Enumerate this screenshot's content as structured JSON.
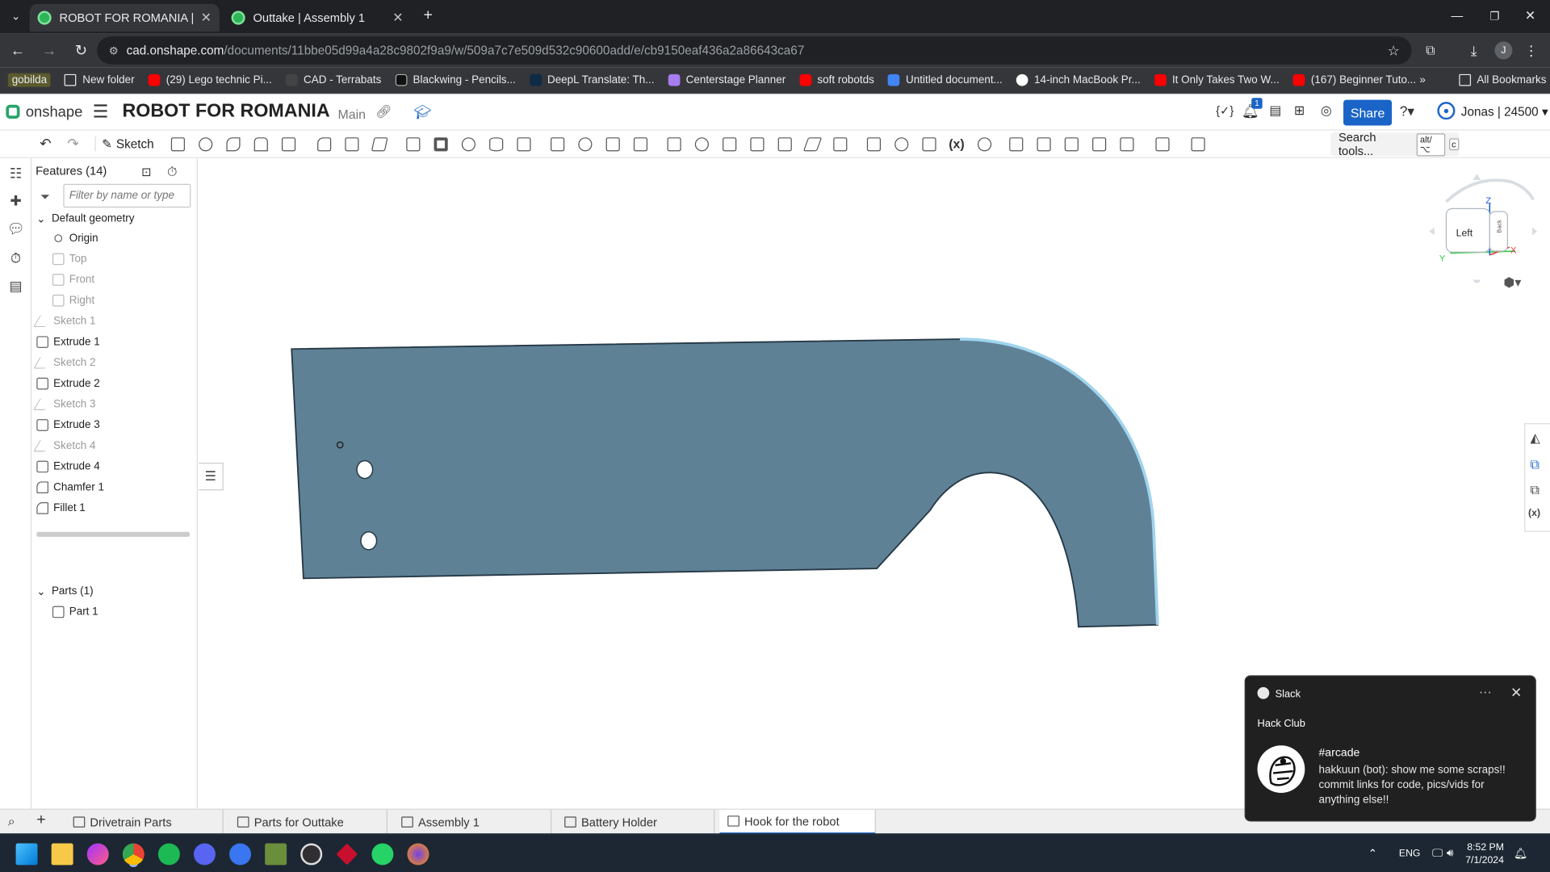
{
  "browser": {
    "tabs": [
      {
        "label": "ROBOT FOR ROMANIA | Hook f",
        "active": true
      },
      {
        "label": "Outtake | Assembly 1",
        "active": false
      }
    ],
    "url_host": "cad.onshape.com",
    "url_path": "/documents/11bbe05d99a4a28c9802f9a9/w/509a7c7e509d532c90600add/e/cb9150eaf436a2a86643ca67",
    "profile_initial": "J",
    "bookmarks": [
      {
        "label": "gobilda"
      },
      {
        "label": "New folder"
      },
      {
        "label": "(29) Lego technic Pi..."
      },
      {
        "label": "CAD - Terrabats"
      },
      {
        "label": "Blackwing - Pencils..."
      },
      {
        "label": "DeepL Translate: Th..."
      },
      {
        "label": "Centerstage Planner"
      },
      {
        "label": "soft robotds"
      },
      {
        "label": "Untitled document..."
      },
      {
        "label": "14-inch MacBook Pr..."
      },
      {
        "label": "It Only Takes Two W..."
      },
      {
        "label": "(167) Beginner Tuto..."
      }
    ],
    "more_bookmarks": "»",
    "all_bookmarks": "All Bookmarks"
  },
  "onshape": {
    "logo": "onshape",
    "doc_title": "ROBOT FOR ROMANIA",
    "branch": "Main",
    "notification_count": "1",
    "share_label": "Share",
    "user_label": "Jonas | 24500",
    "sketch_label": "Sketch",
    "search_tools_label": "Search tools...",
    "search_tools_kbd": "alt/⌥",
    "search_tools_kbd2": "c"
  },
  "features": {
    "header": "Features (14)",
    "filter_placeholder": "Filter by name or type",
    "group_label": "Default geometry",
    "items": [
      {
        "label": "Origin",
        "dim": false
      },
      {
        "label": "Top",
        "dim": true
      },
      {
        "label": "Front",
        "dim": true
      },
      {
        "label": "Right",
        "dim": true
      },
      {
        "label": "Sketch 1",
        "dim": true
      },
      {
        "label": "Extrude 1",
        "dim": false
      },
      {
        "label": "Sketch 2",
        "dim": true
      },
      {
        "label": "Extrude 2",
        "dim": false
      },
      {
        "label": "Sketch 3",
        "dim": true
      },
      {
        "label": "Extrude 3",
        "dim": false
      },
      {
        "label": "Sketch 4",
        "dim": true
      },
      {
        "label": "Extrude 4",
        "dim": false
      },
      {
        "label": "Chamfer 1",
        "dim": false
      },
      {
        "label": "Fillet 1",
        "dim": false
      }
    ],
    "parts_header": "Parts (1)",
    "parts": [
      {
        "label": "Part 1"
      }
    ]
  },
  "viewcube": {
    "face_label": "Left",
    "side_label": "Back",
    "axis_z": "Z",
    "axis_y": "Y",
    "axis_x": "X"
  },
  "part_color": "#5f8196",
  "part_edge_color": "#253845",
  "bottom_tabs": [
    {
      "label": "Drivetrain Parts",
      "active": false
    },
    {
      "label": "Parts for Outtake",
      "active": false
    },
    {
      "label": "Assembly 1",
      "active": false
    },
    {
      "label": "Battery Holder",
      "active": false
    },
    {
      "label": "Hook for the robot",
      "active": true
    }
  ],
  "taskbar": {
    "lang": "ENG",
    "time": "8:52 PM",
    "date": "7/1/2024"
  },
  "slack": {
    "app_name": "Slack",
    "workspace": "Hack Club",
    "channel": "#arcade",
    "message": "hakkuun (bot): show me some scraps!! commit links for code, pics/vids for anything else!!"
  }
}
